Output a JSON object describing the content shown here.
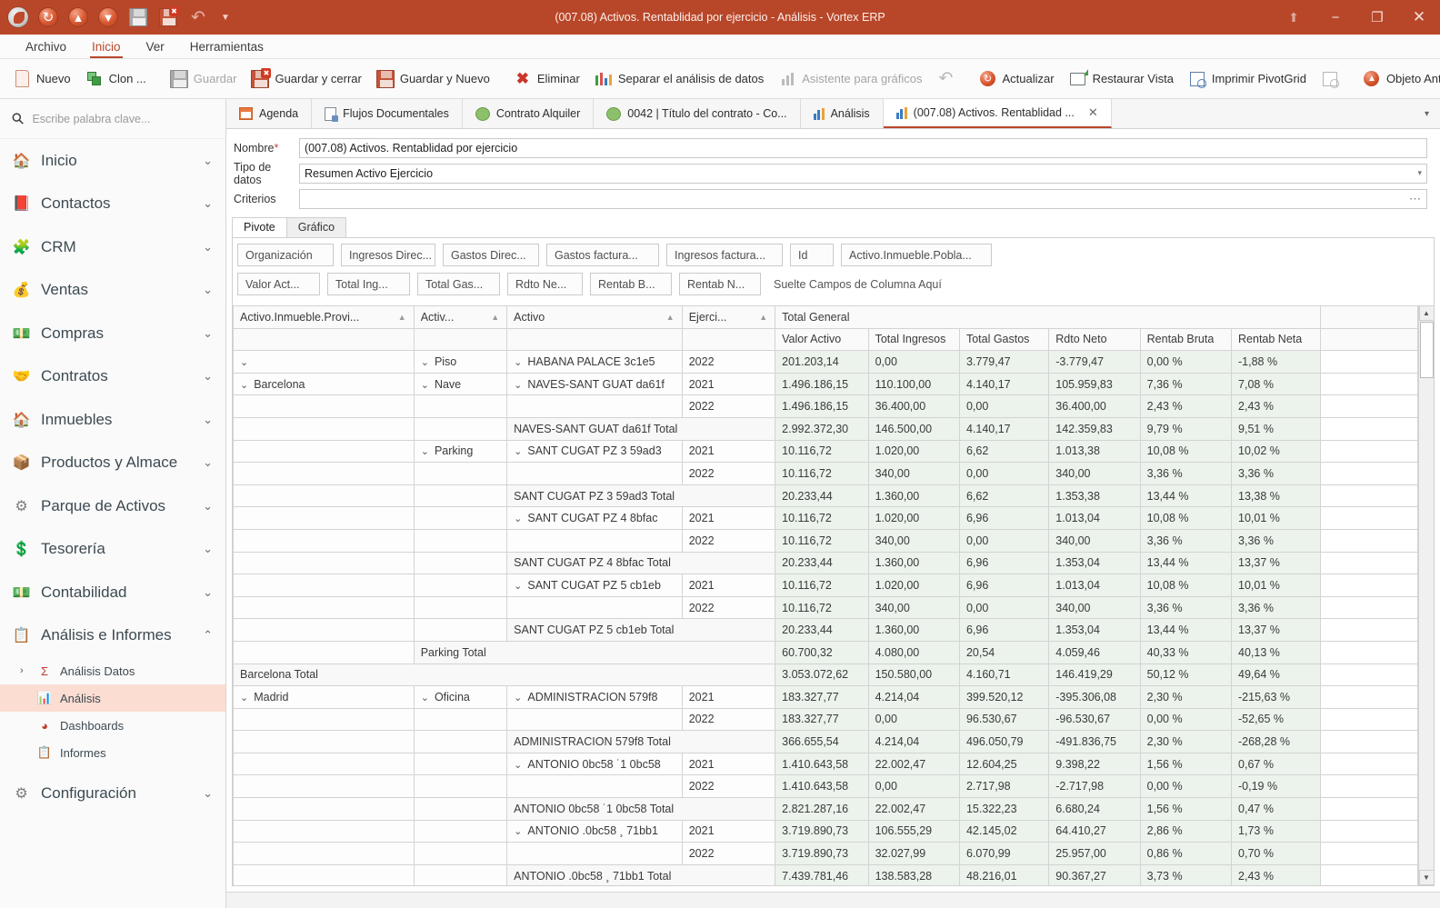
{
  "window": {
    "title": "(007.08) Activos. Rentablidad por ejercicio - Análisis - Vortex ERP",
    "accent": "#b8472a",
    "controls": {
      "ribbon": "⬆",
      "minimize": "−",
      "maximize": "❐",
      "close": "✕"
    }
  },
  "quick_access": [
    {
      "name": "app-orb",
      "label": ""
    },
    {
      "name": "refresh",
      "label": ""
    },
    {
      "name": "up",
      "label": "↑"
    },
    {
      "name": "down",
      "label": "↓"
    },
    {
      "name": "save",
      "label": ""
    },
    {
      "name": "save-close",
      "label": ""
    },
    {
      "name": "undo",
      "label": "↩"
    },
    {
      "name": "more",
      "label": "▾"
    }
  ],
  "menubar": [
    {
      "label": "Archivo",
      "active": false
    },
    {
      "label": "Inicio",
      "active": true
    },
    {
      "label": "Ver",
      "active": false
    },
    {
      "label": "Herramientas",
      "active": false
    }
  ],
  "ribbon": [
    {
      "label": "Nuevo",
      "icon": "new-doc-icon",
      "disabled": false
    },
    {
      "label": "Clon ...",
      "icon": "clone-icon",
      "disabled": false
    },
    {
      "label": "Guardar",
      "icon": "save-icon",
      "disabled": true
    },
    {
      "label": "Guardar y cerrar",
      "icon": "save-close-icon",
      "disabled": false
    },
    {
      "label": "Guardar y Nuevo",
      "icon": "save-new-icon",
      "disabled": false
    },
    {
      "label": "Eliminar",
      "icon": "delete-icon",
      "disabled": false
    },
    {
      "label": "Separar el análisis de datos",
      "icon": "split-analysis-icon",
      "disabled": false
    },
    {
      "label": "Asistente para gráficos",
      "icon": "chart-wizard-icon",
      "disabled": true
    },
    {
      "label": "",
      "icon": "undo-icon",
      "disabled": true
    },
    {
      "label": "Actualizar",
      "icon": "refresh-icon",
      "disabled": false
    },
    {
      "label": "Restaurar Vista",
      "icon": "restore-view-icon",
      "disabled": false
    },
    {
      "label": "Imprimir PivotGrid",
      "icon": "print-pivotgrid-icon",
      "disabled": false
    },
    {
      "label": "",
      "icon": "print-preview-icon",
      "disabled": true
    },
    {
      "label": "Objeto Anterior",
      "icon": "previous-object-icon",
      "disabled": false
    },
    {
      "label": "",
      "icon": "next-object-icon",
      "disabled": false
    },
    {
      "label": "",
      "icon": "close-object-icon",
      "disabled": false
    }
  ],
  "sidebar": {
    "search_placeholder": "Escribe palabra clave...",
    "items": [
      {
        "label": "Inicio",
        "icon": "home-icon",
        "glyph": "🏠",
        "expanded": false
      },
      {
        "label": "Contactos",
        "icon": "contacts-icon",
        "glyph": "📕",
        "expanded": false
      },
      {
        "label": "CRM",
        "icon": "crm-icon",
        "glyph": "🧩",
        "expanded": false
      },
      {
        "label": "Ventas",
        "icon": "sales-icon",
        "glyph": "💰",
        "expanded": false
      },
      {
        "label": "Compras",
        "icon": "purchases-icon",
        "glyph": "💶",
        "expanded": false
      },
      {
        "label": "Contratos",
        "icon": "contracts-icon",
        "glyph": "🤝",
        "expanded": false
      },
      {
        "label": "Inmuebles",
        "icon": "properties-icon",
        "glyph": "🏠",
        "expanded": false
      },
      {
        "label": "Productos y Almace",
        "icon": "products-warehouse-icon",
        "glyph": "📦",
        "expanded": false
      },
      {
        "label": "Parque de Activos",
        "icon": "assets-icon",
        "glyph": "⚙",
        "expanded": false
      },
      {
        "label": "Tesorería",
        "icon": "treasury-icon",
        "glyph": "💱",
        "expanded": false
      },
      {
        "label": "Contabilidad",
        "icon": "accounting-icon",
        "glyph": "💵",
        "expanded": false
      },
      {
        "label": "Análisis e Informes",
        "icon": "analysis-reports-icon",
        "glyph": "📋",
        "expanded": true
      },
      {
        "label": "Configuración",
        "icon": "settings-icon",
        "glyph": "⚙",
        "expanded": false
      }
    ],
    "sub_items": [
      {
        "label": "Análisis Datos",
        "icon": "sigma-icon",
        "caret": "›",
        "selected": false
      },
      {
        "label": "Análisis",
        "icon": "analysis-icon",
        "caret": "",
        "selected": true
      },
      {
        "label": "Dashboards",
        "icon": "dashboards-icon",
        "caret": "",
        "selected": false
      },
      {
        "label": "Informes",
        "icon": "reports-icon",
        "caret": "",
        "selected": false
      }
    ],
    "chevron_collapsed": "⌄",
    "chevron_expanded": "⌃"
  },
  "doc_tabs": [
    {
      "label": "Agenda",
      "icon": "agenda-icon",
      "active": false,
      "closable": false
    },
    {
      "label": "Flujos Documentales",
      "icon": "document-flows-icon",
      "active": false,
      "closable": false
    },
    {
      "label": "Contrato Alquiler",
      "icon": "rental-contract-icon",
      "active": false,
      "closable": false
    },
    {
      "label": "0042 | Título del contrato - Co...",
      "icon": "contract-icon",
      "active": false,
      "closable": false
    },
    {
      "label": "Análisis",
      "icon": "analysis-icon",
      "active": false,
      "closable": false
    },
    {
      "label": "(007.08) Activos. Rentablidad ...",
      "icon": "analysis-icon",
      "active": true,
      "closable": true
    }
  ],
  "tab_close_glyph": "✕",
  "tabstrip_dropdown": "▾",
  "form": {
    "fields": [
      {
        "label": "Nombre",
        "required": true,
        "value": "(007.08) Activos. Rentablidad por ejercicio",
        "control": "text"
      },
      {
        "label": "Tipo de datos",
        "required": false,
        "value": "Resumen Activo Ejercicio",
        "control": "dropdown"
      },
      {
        "label": "Criterios",
        "required": false,
        "value": "",
        "control": "ellipsis"
      }
    ],
    "dropdown_glyph": "▾",
    "ellipsis_glyph": "⋯"
  },
  "pivot_tabs": [
    {
      "label": "Pivote",
      "active": true
    },
    {
      "label": "Gráfico",
      "active": false
    }
  ],
  "field_zone": {
    "row1": [
      "Organización",
      "Ingresos Direc...",
      "Gastos Direc...",
      "Gastos factura...",
      "Ingresos factura...",
      "Id",
      "Activo.Inmueble.Pobla..."
    ],
    "row2": [
      "Valor Act...",
      "Total Ing...",
      "Total Gas...",
      "Rdto Ne...",
      "Rentab B...",
      "Rentab N..."
    ],
    "column_drop_hint": "Suelte Campos de Columna Aquí"
  },
  "chart_data": {
    "type": "table",
    "title": "(007.08) Activos. Rentablidad por ejercicio",
    "row_field_headers": [
      {
        "label": "Activo.Inmueble.Provi...",
        "sort": "▲"
      },
      {
        "label": "Activ...",
        "sort": "▲"
      },
      {
        "label": "Activo",
        "sort": "▲"
      },
      {
        "label": "Ejerci...",
        "sort": "▲"
      }
    ],
    "grand_total_label": "Total General",
    "columns": [
      "Valor Activo",
      "Total Ingresos",
      "Total Gastos",
      "Rdto Neto",
      "Rentab Bruta",
      "Rentab Neta"
    ],
    "rows": [
      {
        "type": "data",
        "provincia": "",
        "provincia_chevron": true,
        "tipo": "Piso",
        "tipo_chevron": true,
        "activo": "HABANA PALACE 3c1e5",
        "activo_chevron": true,
        "ejercicio": "2022",
        "values": [
          "201.203,14",
          "0,00",
          "3.779,47",
          "-3.779,47",
          "0,00 %",
          "-1,88 %"
        ]
      },
      {
        "type": "data",
        "provincia": "Barcelona",
        "provincia_chevron": true,
        "tipo": "Nave",
        "tipo_chevron": true,
        "activo": "NAVES-SANT GUAT da61f",
        "activo_chevron": true,
        "ejercicio": "2021",
        "values": [
          "1.496.186,15",
          "110.100,00",
          "4.140,17",
          "105.959,83",
          "7,36 %",
          "7,08 %"
        ]
      },
      {
        "type": "data",
        "provincia": "",
        "provincia_chevron": false,
        "tipo": "",
        "tipo_chevron": false,
        "activo": "",
        "activo_chevron": false,
        "ejercicio": "2022",
        "values": [
          "1.496.186,15",
          "36.400,00",
          "0,00",
          "36.400,00",
          "2,43 %",
          "2,43 %"
        ]
      },
      {
        "type": "subtotal",
        "label": "NAVES-SANT GUAT da61f Total",
        "level": "activo",
        "values": [
          "2.992.372,30",
          "146.500,00",
          "4.140,17",
          "142.359,83",
          "9,79 %",
          "9,51 %"
        ]
      },
      {
        "type": "data",
        "provincia": "",
        "provincia_chevron": false,
        "tipo": "Parking",
        "tipo_chevron": true,
        "activo": "SANT CUGAT PZ 3 59ad3",
        "activo_chevron": true,
        "ejercicio": "2021",
        "values": [
          "10.116,72",
          "1.020,00",
          "6,62",
          "1.013,38",
          "10,08 %",
          "10,02 %"
        ]
      },
      {
        "type": "data",
        "provincia": "",
        "provincia_chevron": false,
        "tipo": "",
        "tipo_chevron": false,
        "activo": "",
        "activo_chevron": false,
        "ejercicio": "2022",
        "values": [
          "10.116,72",
          "340,00",
          "0,00",
          "340,00",
          "3,36 %",
          "3,36 %"
        ]
      },
      {
        "type": "subtotal",
        "label": "SANT CUGAT PZ 3 59ad3 Total",
        "level": "activo",
        "values": [
          "20.233,44",
          "1.360,00",
          "6,62",
          "1.353,38",
          "13,44 %",
          "13,38 %"
        ]
      },
      {
        "type": "data",
        "provincia": "",
        "provincia_chevron": false,
        "tipo": "",
        "tipo_chevron": false,
        "activo": "SANT CUGAT PZ 4 8bfac",
        "activo_chevron": true,
        "ejercicio": "2021",
        "values": [
          "10.116,72",
          "1.020,00",
          "6,96",
          "1.013,04",
          "10,08 %",
          "10,01 %"
        ]
      },
      {
        "type": "data",
        "provincia": "",
        "provincia_chevron": false,
        "tipo": "",
        "tipo_chevron": false,
        "activo": "",
        "activo_chevron": false,
        "ejercicio": "2022",
        "values": [
          "10.116,72",
          "340,00",
          "0,00",
          "340,00",
          "3,36 %",
          "3,36 %"
        ]
      },
      {
        "type": "subtotal",
        "label": "SANT CUGAT PZ 4 8bfac Total",
        "level": "activo",
        "values": [
          "20.233,44",
          "1.360,00",
          "6,96",
          "1.353,04",
          "13,44 %",
          "13,37 %"
        ]
      },
      {
        "type": "data",
        "provincia": "",
        "provincia_chevron": false,
        "tipo": "",
        "tipo_chevron": false,
        "activo": "SANT CUGAT PZ 5 cb1eb",
        "activo_chevron": true,
        "ejercicio": "2021",
        "values": [
          "10.116,72",
          "1.020,00",
          "6,96",
          "1.013,04",
          "10,08 %",
          "10,01 %"
        ]
      },
      {
        "type": "data",
        "provincia": "",
        "provincia_chevron": false,
        "tipo": "",
        "tipo_chevron": false,
        "activo": "",
        "activo_chevron": false,
        "ejercicio": "2022",
        "values": [
          "10.116,72",
          "340,00",
          "0,00",
          "340,00",
          "3,36 %",
          "3,36 %"
        ]
      },
      {
        "type": "subtotal",
        "label": "SANT CUGAT PZ 5 cb1eb Total",
        "level": "activo",
        "values": [
          "20.233,44",
          "1.360,00",
          "6,96",
          "1.353,04",
          "13,44 %",
          "13,37 %"
        ]
      },
      {
        "type": "subtotal",
        "label": "Parking Total",
        "level": "tipo",
        "values": [
          "60.700,32",
          "4.080,00",
          "20,54",
          "4.059,46",
          "40,33 %",
          "40,13 %"
        ]
      },
      {
        "type": "subtotal",
        "label": "Barcelona Total",
        "level": "provincia",
        "values": [
          "3.053.072,62",
          "150.580,00",
          "4.160,71",
          "146.419,29",
          "50,12 %",
          "49,64 %"
        ]
      },
      {
        "type": "data",
        "provincia": "Madrid",
        "provincia_chevron": true,
        "tipo": "Oficina",
        "tipo_chevron": true,
        "activo": "ADMINISTRACION  579f8",
        "activo_chevron": true,
        "ejercicio": "2021",
        "values": [
          "183.327,77",
          "4.214,04",
          "399.520,12",
          "-395.306,08",
          "2,30 %",
          "-215,63 %"
        ]
      },
      {
        "type": "data",
        "provincia": "",
        "provincia_chevron": false,
        "tipo": "",
        "tipo_chevron": false,
        "activo": "",
        "activo_chevron": false,
        "ejercicio": "2022",
        "values": [
          "183.327,77",
          "0,00",
          "96.530,67",
          "-96.530,67",
          "0,00 %",
          "-52,65 %"
        ]
      },
      {
        "type": "subtotal",
        "label": "ADMINISTRACION  579f8 Total",
        "level": "activo",
        "values": [
          "366.655,54",
          "4.214,04",
          "496.050,79",
          "-491.836,75",
          "2,30 %",
          "-268,28 %"
        ]
      },
      {
        "type": "data",
        "provincia": "",
        "provincia_chevron": false,
        "tipo": "",
        "tipo_chevron": false,
        "activo": "ANTONIO  0bc58 ˙1 0bc58",
        "activo_chevron": true,
        "ejercicio": "2021",
        "values": [
          "1.410.643,58",
          "22.002,47",
          "12.604,25",
          "9.398,22",
          "1,56 %",
          "0,67 %"
        ]
      },
      {
        "type": "data",
        "provincia": "",
        "provincia_chevron": false,
        "tipo": "",
        "tipo_chevron": false,
        "activo": "",
        "activo_chevron": false,
        "ejercicio": "2022",
        "values": [
          "1.410.643,58",
          "0,00",
          "2.717,98",
          "-2.717,98",
          "0,00 %",
          "-0,19 %"
        ]
      },
      {
        "type": "subtotal",
        "label": "ANTONIO  0bc58 ˙1 0bc58 Total",
        "level": "activo",
        "values": [
          "2.821.287,16",
          "22.002,47",
          "15.322,23",
          "6.680,24",
          "1,56 %",
          "0,47 %"
        ]
      },
      {
        "type": "data",
        "provincia": "",
        "provincia_chevron": false,
        "tipo": "",
        "tipo_chevron": false,
        "activo": "ANTONIO .0bc58 ¸ 71bb1",
        "activo_chevron": true,
        "ejercicio": "2021",
        "values": [
          "3.719.890,73",
          "106.555,29",
          "42.145,02",
          "64.410,27",
          "2,86 %",
          "1,73 %"
        ]
      },
      {
        "type": "data",
        "provincia": "",
        "provincia_chevron": false,
        "tipo": "",
        "tipo_chevron": false,
        "activo": "",
        "activo_chevron": false,
        "ejercicio": "2022",
        "values": [
          "3.719.890,73",
          "32.027,99",
          "6.070,99",
          "25.957,00",
          "0,86 %",
          "0,70 %"
        ]
      },
      {
        "type": "subtotal",
        "label": "ANTONIO .0bc58 ¸ 71bb1 Total",
        "level": "activo",
        "values": [
          "7.439.781,46",
          "138.583,28",
          "48.216,01",
          "90.367,27",
          "3,73 %",
          "2,43 %"
        ]
      }
    ],
    "row_chevron": "⌄"
  },
  "scrollbar": {
    "up": "▲",
    "down": "▼"
  }
}
